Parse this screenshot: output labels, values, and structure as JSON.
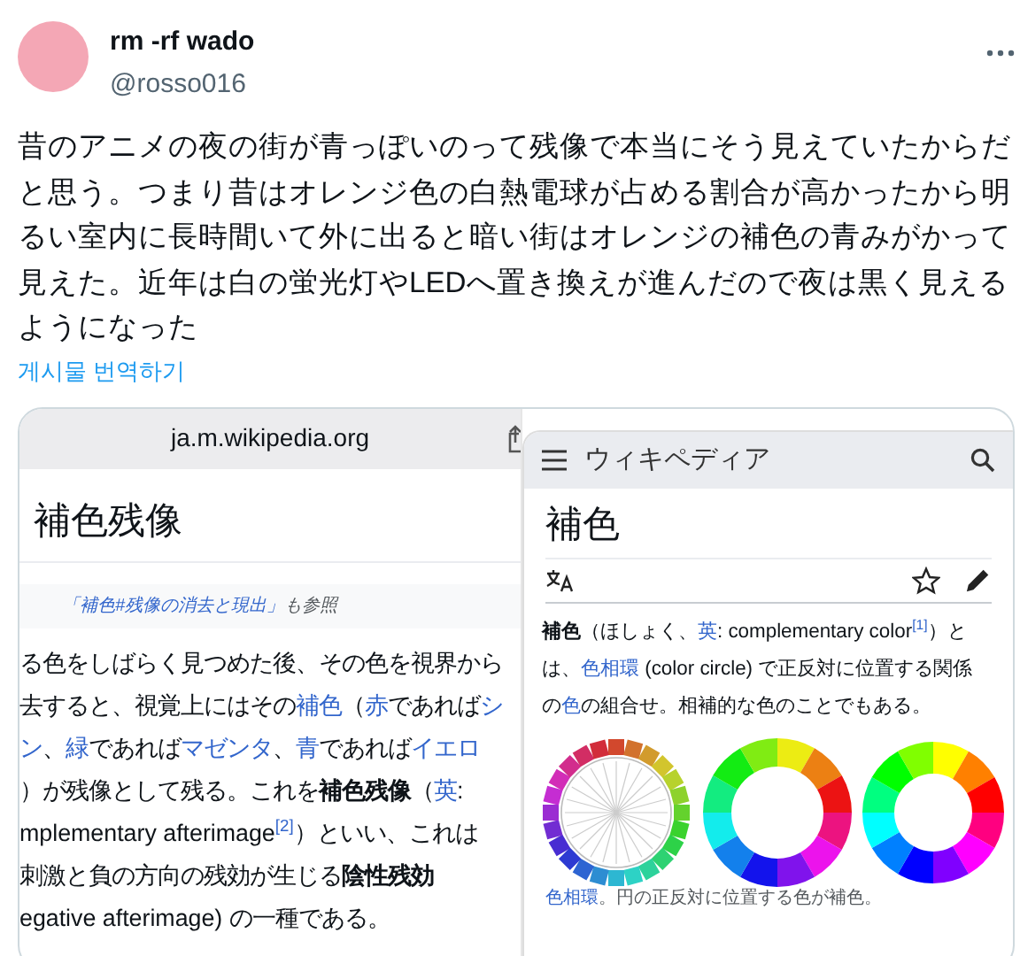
{
  "post": {
    "author_name": "rm -rf wado",
    "handle": "@rosso016",
    "text": "昔のアニメの夜の街が青っぽいのって残像で本当にそう見えていたからだと思う。つまり昔はオレンジ色の白熱電球が占める割合が高かったから明るい室内に長時間いて外に出ると暗い街はオレンジの補色の青みがかって見えた。近年は白の蛍光灯やLEDへ置き換えが進んだので夜は黒く見えるようになった",
    "translate_link": "게시물 번역하기"
  },
  "left_screen": {
    "address": "ja.m.wikipedia.org",
    "title": "補色残像",
    "hatnote": [
      {
        "text": "「補色#残像の消去と現出」",
        "kind": "link"
      },
      {
        "text": "も参照",
        "kind": "plain"
      }
    ],
    "lines": [
      [
        {
          "text": "る色をしばらく見つめた後、その色を視界から",
          "kind": "plain"
        }
      ],
      [
        {
          "text": "去すると、視覚上にはその",
          "kind": "plain"
        },
        {
          "text": "補色",
          "kind": "link"
        },
        {
          "text": "（",
          "kind": "plain"
        },
        {
          "text": "赤",
          "kind": "link"
        },
        {
          "text": "であれば",
          "kind": "plain"
        },
        {
          "text": "シ",
          "kind": "link"
        }
      ],
      [
        {
          "text": "ン",
          "kind": "link"
        },
        {
          "text": "、",
          "kind": "plain"
        },
        {
          "text": "緑",
          "kind": "link"
        },
        {
          "text": "であれば",
          "kind": "plain"
        },
        {
          "text": "マゼンタ",
          "kind": "link"
        },
        {
          "text": "、",
          "kind": "plain"
        },
        {
          "text": "青",
          "kind": "link"
        },
        {
          "text": "であれば",
          "kind": "plain"
        },
        {
          "text": "イエロ",
          "kind": "link"
        }
      ],
      [
        {
          "text": "）が残像として残る。これを",
          "kind": "plain"
        },
        {
          "text": "補色残像",
          "kind": "bold"
        },
        {
          "text": "（",
          "kind": "plain"
        },
        {
          "text": "英",
          "kind": "link"
        },
        {
          "text": ":",
          "kind": "plain"
        }
      ],
      [
        {
          "text": "mplementary afterimage",
          "kind": "plain"
        },
        {
          "text": "[2]",
          "kind": "ref"
        },
        {
          "text": "）といい、これは",
          "kind": "plain"
        }
      ],
      [
        {
          "text": "刺激と負の方向の残効が生じる",
          "kind": "plain"
        },
        {
          "text": "陰性残効",
          "kind": "bold"
        }
      ],
      [
        {
          "text": "egative afterimage) の一種である。",
          "kind": "plain"
        }
      ]
    ]
  },
  "right_screen": {
    "site_name": "ウィキペディア",
    "title": "補色",
    "lines": [
      [
        {
          "text": "補色",
          "kind": "bold"
        },
        {
          "text": "（ほしょく、",
          "kind": "plain"
        },
        {
          "text": "英",
          "kind": "link"
        },
        {
          "text": ": complementary color",
          "kind": "plain"
        },
        {
          "text": "[1]",
          "kind": "ref"
        },
        {
          "text": "）と",
          "kind": "plain"
        }
      ],
      [
        {
          "text": "は、",
          "kind": "plain"
        },
        {
          "text": "色相環",
          "kind": "link"
        },
        {
          "text": " (color circle) で正反対に位置する関係",
          "kind": "plain"
        }
      ],
      [
        {
          "text": "の",
          "kind": "plain"
        },
        {
          "text": "色",
          "kind": "link"
        },
        {
          "text": "の組合せ。相補的な色のことでもある。",
          "kind": "plain"
        }
      ]
    ],
    "caption": [
      {
        "text": "色相環",
        "kind": "link"
      },
      {
        "text": "。円の正反対に位置する色が補色。",
        "kind": "plain"
      }
    ]
  }
}
